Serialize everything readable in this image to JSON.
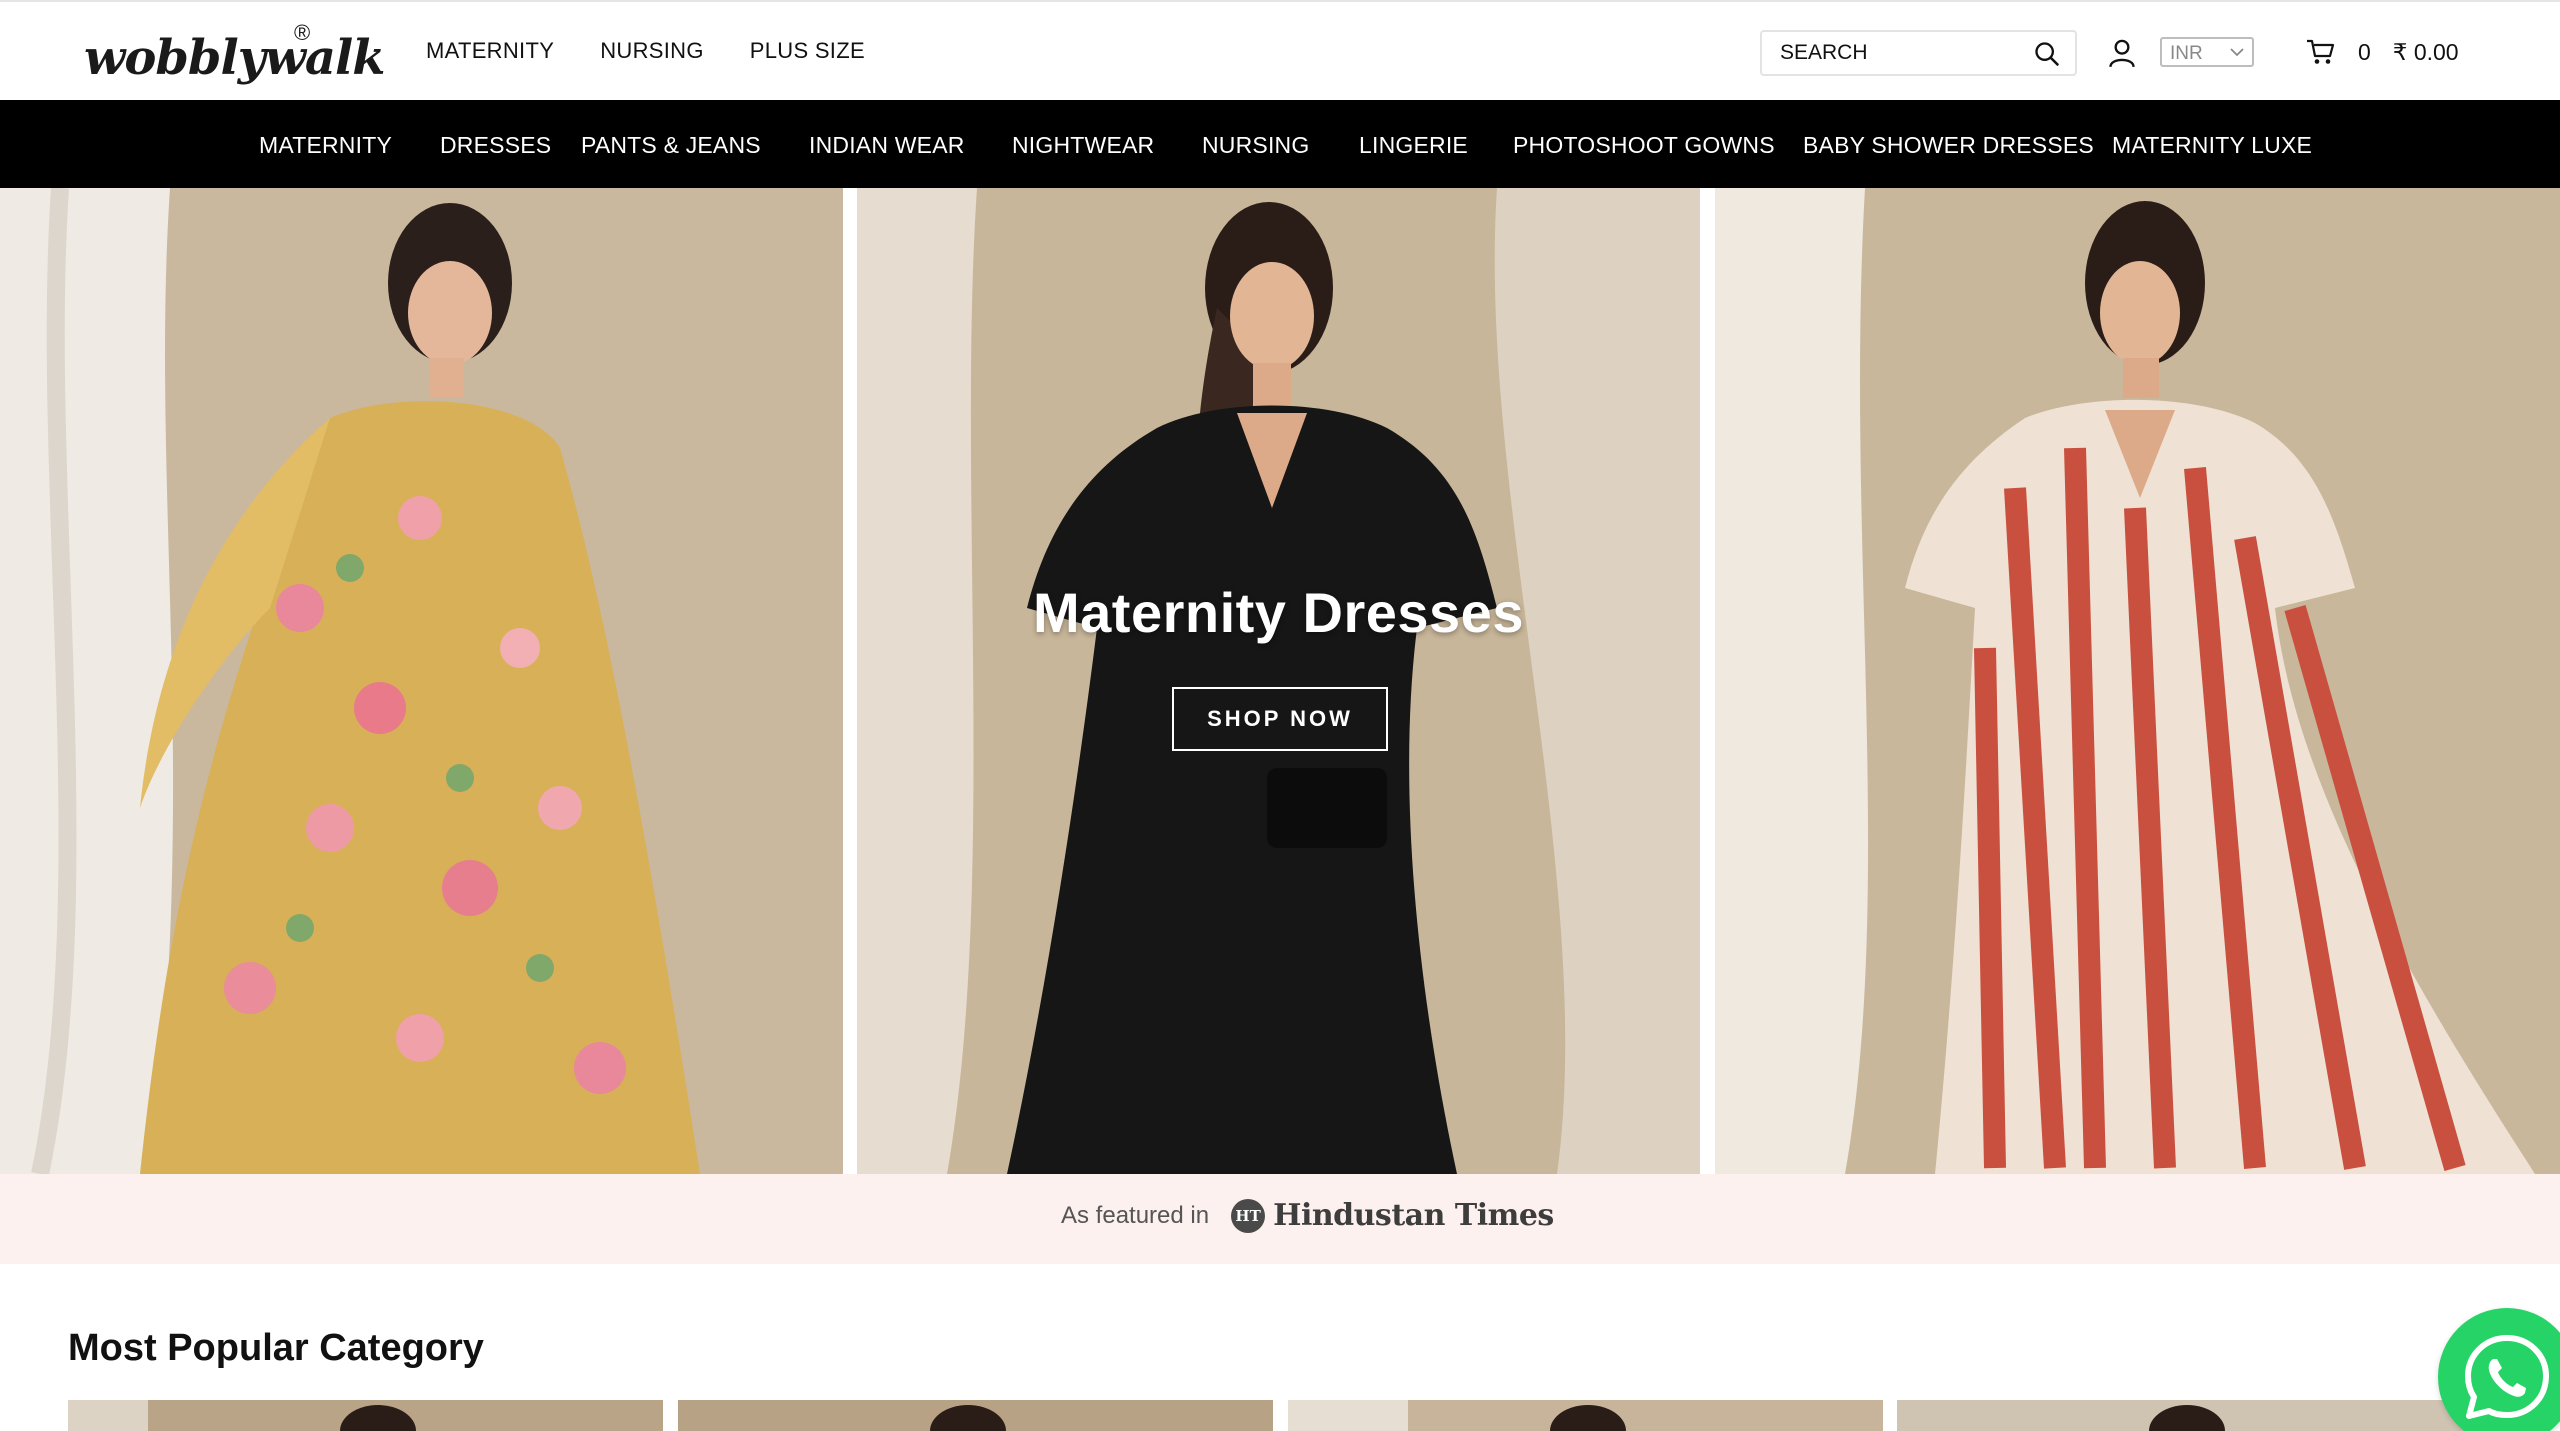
{
  "brand": {
    "name": "wobblywalk",
    "registered": "®"
  },
  "topnav": {
    "items": [
      "MATERNITY",
      "NURSING",
      "PLUS SIZE"
    ]
  },
  "search": {
    "placeholder": "SEARCH",
    "icon": "search-icon"
  },
  "account": {
    "icon": "user-icon"
  },
  "currency": {
    "selected": "INR"
  },
  "cart": {
    "icon": "cart-icon",
    "count": "0",
    "total": "₹ 0.00"
  },
  "catnav": {
    "items": [
      "MATERNITY",
      "DRESSES",
      "PANTS & JEANS",
      "INDIAN WEAR",
      "NIGHTWEAR",
      "NURSING",
      "LINGERIE",
      "PHOTOSHOOT GOWNS",
      "BABY SHOWER DRESSES",
      "MATERNITY LUXE"
    ]
  },
  "hero": {
    "title": "Maternity Dresses",
    "cta": "SHOP NOW"
  },
  "featured": {
    "label": "As featured in",
    "publication": "Hindustan Times",
    "publication_mark": "HT"
  },
  "popular": {
    "title": "Most Popular Category"
  },
  "whatsapp": {
    "icon": "whatsapp-icon"
  },
  "colors": {
    "nav_bg": "#000000",
    "featured_bg": "#fdf1ef",
    "whatsapp": "#25d366"
  }
}
